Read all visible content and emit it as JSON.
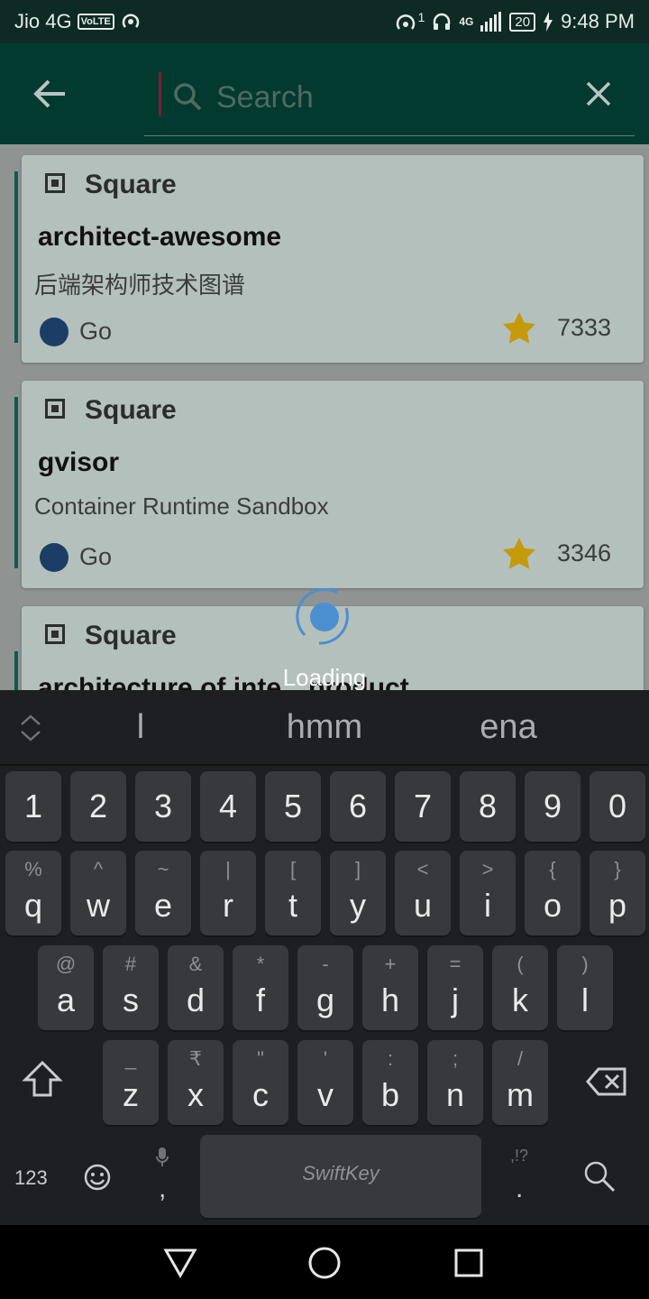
{
  "status_bar": {
    "carrier": "Jio 4G",
    "volte": "VoLTE",
    "signal_sup": "1",
    "net": "4G",
    "battery": "20",
    "time": "9:48 PM"
  },
  "search": {
    "placeholder": "Search",
    "value": ""
  },
  "repos": [
    {
      "owner": "Square",
      "name": "architect-awesome",
      "description": "后端架构师技术图谱",
      "language": "Go",
      "language_color": "#1c3e66",
      "stars": "7333"
    },
    {
      "owner": "Square",
      "name": "gvisor",
      "description": "Container Runtime Sandbox",
      "language": "Go",
      "language_color": "#1c3e66",
      "stars": "3346"
    },
    {
      "owner": "Square",
      "name": "architecture of inte…product",
      "description": "",
      "language": "",
      "stars": ""
    }
  ],
  "loading": {
    "text": "Loading"
  },
  "keyboard": {
    "suggestions": [
      "l",
      "hmm",
      "ena"
    ],
    "number_row": [
      "1",
      "2",
      "3",
      "4",
      "5",
      "6",
      "7",
      "8",
      "9",
      "0"
    ],
    "row1": [
      {
        "main": "q",
        "sub": "%"
      },
      {
        "main": "w",
        "sub": "^"
      },
      {
        "main": "e",
        "sub": "~"
      },
      {
        "main": "r",
        "sub": "|"
      },
      {
        "main": "t",
        "sub": "["
      },
      {
        "main": "y",
        "sub": "]"
      },
      {
        "main": "u",
        "sub": "<"
      },
      {
        "main": "i",
        "sub": ">"
      },
      {
        "main": "o",
        "sub": "{"
      },
      {
        "main": "p",
        "sub": "}"
      }
    ],
    "row2": [
      {
        "main": "a",
        "sub": "@"
      },
      {
        "main": "s",
        "sub": "#"
      },
      {
        "main": "d",
        "sub": "&"
      },
      {
        "main": "f",
        "sub": "*"
      },
      {
        "main": "g",
        "sub": "-"
      },
      {
        "main": "h",
        "sub": "+"
      },
      {
        "main": "j",
        "sub": "="
      },
      {
        "main": "k",
        "sub": "("
      },
      {
        "main": "l",
        "sub": ")"
      }
    ],
    "row3": [
      {
        "main": "z",
        "sub": "_"
      },
      {
        "main": "x",
        "sub": "₹"
      },
      {
        "main": "c",
        "sub": "\""
      },
      {
        "main": "v",
        "sub": "'"
      },
      {
        "main": "b",
        "sub": ":"
      },
      {
        "main": "n",
        "sub": ";"
      },
      {
        "main": "m",
        "sub": "/"
      }
    ],
    "numbers_key": "123",
    "comma": ",",
    "period": ".",
    "period_alt": ",!?",
    "space_label": "SwiftKey"
  }
}
